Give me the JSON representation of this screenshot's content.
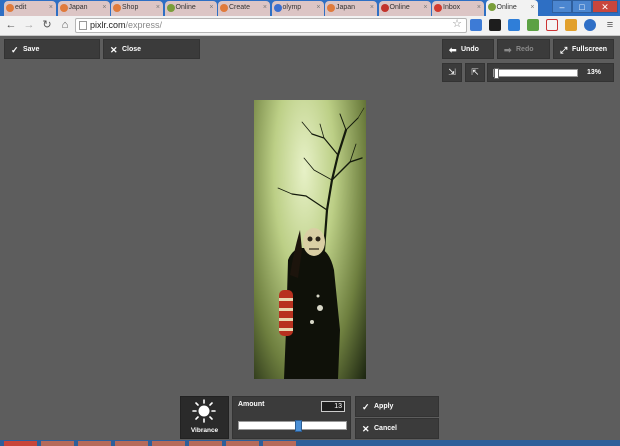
{
  "browser": {
    "tabs": [
      {
        "label": "edit",
        "active": false,
        "favicon_color": "#e07b3c"
      },
      {
        "label": "Japan",
        "active": false,
        "favicon_color": "#e07b3c"
      },
      {
        "label": "Shop",
        "active": false,
        "favicon_color": "#e07b3c"
      },
      {
        "label": "Online",
        "active": false,
        "favicon_color": "#7a9e3a"
      },
      {
        "label": "Create",
        "active": false,
        "favicon_color": "#e07b3c"
      },
      {
        "label": "olymp",
        "active": false,
        "favicon_color": "#3b6fd0"
      },
      {
        "label": "Japan",
        "active": false,
        "favicon_color": "#e07b3c"
      },
      {
        "label": "Online",
        "active": false,
        "favicon_color": "#c2332b"
      },
      {
        "label": "Inbox",
        "active": false,
        "favicon_color": "#d23a2e"
      },
      {
        "label": "Online",
        "active": true,
        "favicon_color": "#7a9e3a"
      }
    ],
    "url_domain": "pixlr.com",
    "url_path": "/express/",
    "window_controls": {
      "minimize": "–",
      "maximize": "□",
      "close": "✕"
    }
  },
  "editor": {
    "save_label": "Save",
    "close_label": "Close",
    "undo_label": "Undo",
    "redo_label": "Redo",
    "fullscreen_label": "Fullscreen",
    "zoom_value": "13%",
    "zoom_fraction": 0.0,
    "tool_name": "Vibrance",
    "amount_label": "Amount",
    "amount_value": "13",
    "amount_fraction": 0.56,
    "apply_label": "Apply",
    "cancel_label": "Cancel"
  },
  "colors": {
    "app_background": "#5d5d5d",
    "panel": "#3b3b3b",
    "accent_handle": "#4a8fd6",
    "chrome_blue": "#2e6fc4"
  }
}
